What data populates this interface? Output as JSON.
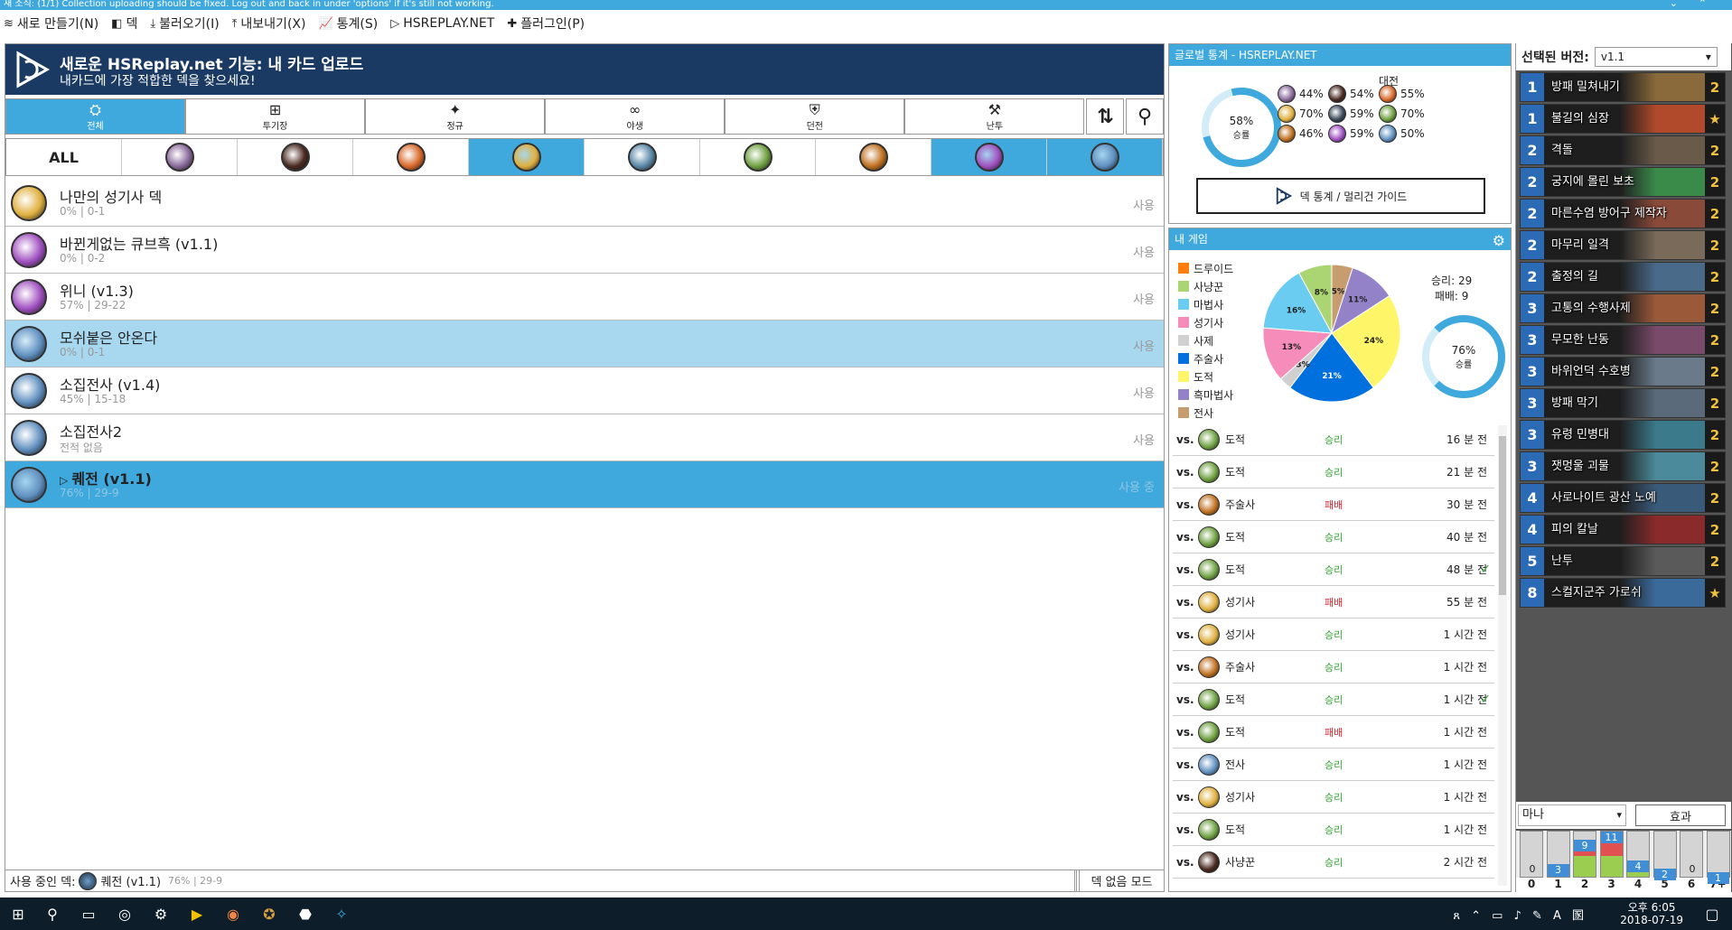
{
  "titlebar": {
    "text": "새 소식: (1/1) Collection uploading should be fixed. Log out and back in under 'options' if it's still not working.",
    "controls": [
      "⌄",
      "⌃"
    ]
  },
  "menu": [
    {
      "icon": "stack-icon",
      "label": "새로 만들기(N)"
    },
    {
      "icon": "cards-icon",
      "label": "덱"
    },
    {
      "icon": "download-icon",
      "label": "불러오기(I)"
    },
    {
      "icon": "upload-icon",
      "label": "내보내기(X)"
    },
    {
      "icon": "stats-icon",
      "label": "통계(S)"
    },
    {
      "icon": "hsreplay-icon",
      "label": "HSREPLAY.NET"
    },
    {
      "icon": "puzzle-icon",
      "label": "플러그인(P)"
    }
  ],
  "banner": {
    "title": "새로운 HSReplay.net 기능: 내 카드 업로드",
    "subtitle": "내카드에 가장 적합한 덱을 찾으세요!"
  },
  "filters": [
    {
      "icon": "⛭",
      "label": "전체",
      "active": true
    },
    {
      "icon": "⊞",
      "label": "투기장",
      "active": false
    },
    {
      "icon": "✦",
      "label": "정규",
      "active": false
    },
    {
      "icon": "∞",
      "label": "야생",
      "active": false
    },
    {
      "icon": "⛨",
      "label": "던전",
      "active": false
    },
    {
      "icon": "⚒",
      "label": "난투",
      "active": false
    }
  ],
  "tools": {
    "sort": "⇅",
    "search": "⚲"
  },
  "classes": {
    "all_label": "ALL",
    "items": [
      {
        "name": "druid",
        "color": "#8a6a9c",
        "active": false
      },
      {
        "name": "warlock",
        "color": "#4a2a20",
        "active": false
      },
      {
        "name": "mage",
        "color": "#d8682a",
        "active": false
      },
      {
        "name": "paladin",
        "color": "#e0b040",
        "active": true
      },
      {
        "name": "priest",
        "color": "#5a88a8",
        "active": false
      },
      {
        "name": "hunter",
        "color": "#6ea040",
        "active": false
      },
      {
        "name": "shaman",
        "color": "#c07020",
        "active": false
      },
      {
        "name": "rogue",
        "color": "#a050c0",
        "active": true
      },
      {
        "name": "warrior",
        "color": "#6090c0",
        "active": true
      }
    ]
  },
  "decks": [
    {
      "name": "나만의 성기사 덱",
      "stat": "0% | 0-1",
      "use": "사용",
      "color": "#e0b040",
      "style": ""
    },
    {
      "name": "바뀐게없는 큐브흑 (v1.1)",
      "stat": "0% | 0-2",
      "use": "사용",
      "color": "#a050c0",
      "style": ""
    },
    {
      "name": "위니 (v1.3)",
      "stat": "57% | 29-22",
      "use": "사용",
      "color": "#a050c0",
      "style": ""
    },
    {
      "name": "모쉬붙은 안온다",
      "stat": "0% | 0-1",
      "use": "사용",
      "color": "#6090c0",
      "style": "hl"
    },
    {
      "name": "소집전사 (v1.4)",
      "stat": "45% | 15-18",
      "use": "사용",
      "color": "#6090c0",
      "style": ""
    },
    {
      "name": "소집전사2",
      "stat": "전적 없음",
      "use": "사용",
      "color": "#6090c0",
      "style": ""
    },
    {
      "name": "퀘전 (v1.1)",
      "stat": "76% | 29-9",
      "use": "사용 중",
      "color": "#6090c0",
      "style": "sel"
    }
  ],
  "footer": {
    "label": "사용 중인 덱:",
    "deck": "퀘전 (v1.1)",
    "stat": "76% | 29-9",
    "button": "덱 없음 모드"
  },
  "global": {
    "header": "글로벌 통계 - HSREPLAY.NET",
    "winrate": "58%",
    "winrate_label": "승률",
    "matchup_title": "대전",
    "matchups": [
      {
        "pct": "44%",
        "color": "#8a6a9c"
      },
      {
        "pct": "54%",
        "color": "#4a2a20"
      },
      {
        "pct": "55%",
        "color": "#d8682a"
      },
      {
        "pct": "70%",
        "color": "#e0b040"
      },
      {
        "pct": "59%",
        "color": "#3a4a5a"
      },
      {
        "pct": "70%",
        "color": "#6ea040"
      },
      {
        "pct": "46%",
        "color": "#c07020"
      },
      {
        "pct": "59%",
        "color": "#a050c0"
      },
      {
        "pct": "50%",
        "color": "#6090c0"
      }
    ],
    "button": "덱 통계 / 멀리건 가이드"
  },
  "mygames": {
    "header": "내 게임",
    "legend": [
      {
        "label": "드루이드",
        "color": "#ff7d0a"
      },
      {
        "label": "사냥꾼",
        "color": "#abd473"
      },
      {
        "label": "마법사",
        "color": "#69ccf0"
      },
      {
        "label": "성기사",
        "color": "#f58cba"
      },
      {
        "label": "사제",
        "color": "#d0d0d0"
      },
      {
        "label": "주술사",
        "color": "#0070de"
      },
      {
        "label": "도적",
        "color": "#fff569"
      },
      {
        "label": "흑마법사",
        "color": "#9482c9"
      },
      {
        "label": "전사",
        "color": "#c79c6e"
      }
    ],
    "pie": [
      {
        "label": "5%",
        "value": 5,
        "color": "#c79c6e"
      },
      {
        "label": "11%",
        "value": 11,
        "color": "#9482c9"
      },
      {
        "label": "24%",
        "value": 24,
        "color": "#fff569"
      },
      {
        "label": "21%",
        "value": 21,
        "color": "#0070de"
      },
      {
        "label": "3%",
        "value": 3,
        "color": "#d0d0d0"
      },
      {
        "label": "13%",
        "value": 13,
        "color": "#f58cba"
      },
      {
        "label": "16%",
        "value": 16,
        "color": "#69ccf0"
      },
      {
        "label": "8%",
        "value": 8,
        "color": "#abd473"
      }
    ],
    "wins": "승리: 29",
    "losses": "패배: 9",
    "winrate": "76%",
    "winrate_label": "승률",
    "games": [
      {
        "vs": "vs.",
        "cls": "도적",
        "color": "#6ea040",
        "res": "승리",
        "win": true,
        "time": "16 분 전",
        "check": ""
      },
      {
        "vs": "vs.",
        "cls": "도적",
        "color": "#6ea040",
        "res": "승리",
        "win": true,
        "time": "21 분 전",
        "check": ""
      },
      {
        "vs": "vs.",
        "cls": "주술사",
        "color": "#c07020",
        "res": "패배",
        "win": false,
        "time": "30 분 전",
        "check": ""
      },
      {
        "vs": "vs.",
        "cls": "도적",
        "color": "#6ea040",
        "res": "승리",
        "win": true,
        "time": "40 분 전",
        "check": ""
      },
      {
        "vs": "vs.",
        "cls": "도적",
        "color": "#6ea040",
        "res": "승리",
        "win": true,
        "time": "48 분 전",
        "check": "✓"
      },
      {
        "vs": "vs.",
        "cls": "성기사",
        "color": "#e0b040",
        "res": "패배",
        "win": false,
        "time": "55 분 전",
        "check": ""
      },
      {
        "vs": "vs.",
        "cls": "성기사",
        "color": "#e0b040",
        "res": "승리",
        "win": true,
        "time": "1 시간 전",
        "check": ""
      },
      {
        "vs": "vs.",
        "cls": "주술사",
        "color": "#c07020",
        "res": "승리",
        "win": true,
        "time": "1 시간 전",
        "check": ""
      },
      {
        "vs": "vs.",
        "cls": "도적",
        "color": "#6ea040",
        "res": "승리",
        "win": true,
        "time": "1 시간 전",
        "check": "✓"
      },
      {
        "vs": "vs.",
        "cls": "도적",
        "color": "#6ea040",
        "res": "패배",
        "win": false,
        "time": "1 시간 전",
        "check": ""
      },
      {
        "vs": "vs.",
        "cls": "전사",
        "color": "#6090c0",
        "res": "승리",
        "win": true,
        "time": "1 시간 전",
        "check": ""
      },
      {
        "vs": "vs.",
        "cls": "성기사",
        "color": "#e0b040",
        "res": "승리",
        "win": true,
        "time": "1 시간 전",
        "check": ""
      },
      {
        "vs": "vs.",
        "cls": "도적",
        "color": "#6ea040",
        "res": "승리",
        "win": true,
        "time": "1 시간 전",
        "check": ""
      },
      {
        "vs": "vs.",
        "cls": "사냥꾼",
        "color": "#4a2a20",
        "res": "승리",
        "win": true,
        "time": "2 시간 전",
        "check": ""
      }
    ]
  },
  "version": {
    "label": "선택된 버전:",
    "value": "v1.1"
  },
  "cards": [
    {
      "cost": "1",
      "name": "방패 밀쳐내기",
      "count": "2",
      "art": "#8a6a3a"
    },
    {
      "cost": "1",
      "name": "불길의 심장",
      "count": "★",
      "art": "#b04a2a"
    },
    {
      "cost": "2",
      "name": "격돌",
      "count": "2",
      "art": "#6a5a4a"
    },
    {
      "cost": "2",
      "name": "궁지에 몰린 보초",
      "count": "2",
      "art": "#3a8a4a"
    },
    {
      "cost": "2",
      "name": "마른수염 방어구 제작자",
      "count": "2",
      "art": "#8a4a3a"
    },
    {
      "cost": "2",
      "name": "마무리 일격",
      "count": "2",
      "art": "#7a6a5a"
    },
    {
      "cost": "2",
      "name": "출정의 길",
      "count": "2",
      "art": "#4a6a8a"
    },
    {
      "cost": "3",
      "name": "고통의 수행사제",
      "count": "2",
      "art": "#9a5a3a"
    },
    {
      "cost": "3",
      "name": "무모한 난동",
      "count": "2",
      "art": "#7a4a6a"
    },
    {
      "cost": "3",
      "name": "바위언덕 수호병",
      "count": "2",
      "art": "#6a7a8a"
    },
    {
      "cost": "3",
      "name": "방패 막기",
      "count": "2",
      "art": "#5a6a7a"
    },
    {
      "cost": "3",
      "name": "유령 민병대",
      "count": "2",
      "art": "#3a7a8a"
    },
    {
      "cost": "3",
      "name": "잿멍울 괴물",
      "count": "2",
      "art": "#4a8a9a"
    },
    {
      "cost": "4",
      "name": "사로나이트 광산 노예",
      "count": "2",
      "art": "#3a5a7a"
    },
    {
      "cost": "4",
      "name": "피의 칼날",
      "count": "2",
      "art": "#8a2a2a"
    },
    {
      "cost": "5",
      "name": "난투",
      "count": "2",
      "art": "#5a5a5a"
    },
    {
      "cost": "8",
      "name": "스컬지군주 가로쉬",
      "count": "★",
      "art": "#3a6a9a"
    }
  ],
  "mana": {
    "select": "마나",
    "button": "효과"
  },
  "curve": [
    {
      "label": "0",
      "count": 0,
      "spell": 0
    },
    {
      "label": "1",
      "count": 3,
      "spell": 0
    },
    {
      "label": "2",
      "count": 9,
      "spell": 4
    },
    {
      "label": "3",
      "count": 11,
      "spell": 6
    },
    {
      "label": "4",
      "count": 4,
      "spell": 2
    },
    {
      "label": "5",
      "count": 2,
      "spell": 0
    },
    {
      "label": "6",
      "count": 0,
      "spell": 0
    },
    {
      "label": "7+",
      "count": 1,
      "spell": 0
    }
  ],
  "curve_max": 11,
  "taskbar": {
    "time": "오후 6:05",
    "date": "2018-07-19",
    "tray": "ጸ ⌃ ▭ ♪ ✎ A 圂"
  }
}
